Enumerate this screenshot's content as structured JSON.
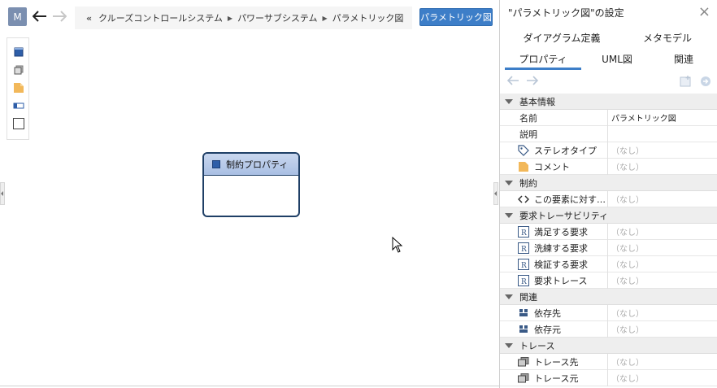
{
  "toolbar": {
    "model_badge": "M",
    "back_arrow": "←",
    "forward_arrow": "→",
    "breadcrumb_start": "«",
    "breadcrumb": [
      "クルーズコントロールシステム",
      "パワーサブシステム",
      "パラメトリック図"
    ],
    "diagram_type_button": "パラメトリック図"
  },
  "palette": {
    "items": [
      "block-icon",
      "part-icon",
      "note-icon",
      "property-icon",
      "frame-icon"
    ]
  },
  "diagram": {
    "element_label": "制約プロパティ"
  },
  "panel": {
    "title": "\"パラメトリック図\"の設定",
    "close": "×",
    "tabs_row1": [
      "ダイアグラム定義",
      "メタモデル"
    ],
    "tabs_row2": [
      "プロパティ",
      "UML図",
      "関連"
    ],
    "active_tab": "プロパティ",
    "none_text": "（なし）",
    "sections": [
      {
        "label": "基本情報"
      },
      {
        "label": "制約"
      },
      {
        "label": "要求トレーサビリティ"
      },
      {
        "label": "関連"
      },
      {
        "label": "トレース"
      }
    ],
    "props": {
      "name": {
        "label": "名前",
        "value": "パラメトリック図"
      },
      "description": {
        "label": "説明",
        "value": ""
      },
      "stereotype": {
        "label": "ステレオタイプ",
        "value": "（なし）"
      },
      "comment": {
        "label": "コメント",
        "value": "（なし）"
      },
      "constraint": {
        "label": "この要素に対す…",
        "value": "（なし）"
      },
      "satisfy": {
        "label": "満足する要求",
        "value": "（なし）"
      },
      "refine": {
        "label": "洗練する要求",
        "value": "（なし）"
      },
      "verify": {
        "label": "検証する要求",
        "value": "（なし）"
      },
      "trace_req": {
        "label": "要求トレース",
        "value": "（なし）"
      },
      "dep_to": {
        "label": "依存先",
        "value": "（なし）"
      },
      "dep_from": {
        "label": "依存元",
        "value": "（なし）"
      },
      "trace_to": {
        "label": "トレース先",
        "value": "（なし）"
      },
      "trace_from": {
        "label": "トレース元",
        "value": "（なし）"
      }
    }
  }
}
